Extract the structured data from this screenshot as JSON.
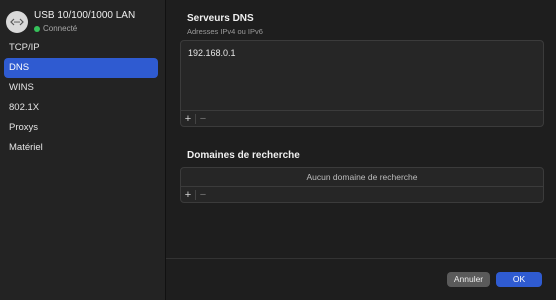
{
  "sidebar": {
    "interface": {
      "icon": "ethernet-icon",
      "title": "USB 10/100/1000 LAN",
      "status": "Connecté",
      "status_color": "#36c25b"
    },
    "items": [
      {
        "label": "TCP/IP"
      },
      {
        "label": "DNS",
        "selected": true
      },
      {
        "label": "WINS"
      },
      {
        "label": "802.1X"
      },
      {
        "label": "Proxys"
      },
      {
        "label": "Matériel"
      }
    ]
  },
  "dns_servers": {
    "title": "Serveurs DNS",
    "subtitle": "Adresses IPv4 ou IPv6",
    "entries": [
      "192.168.0.1"
    ],
    "add_label": "+",
    "remove_label": "−"
  },
  "search_domains": {
    "title": "Domaines de recherche",
    "empty_text": "Aucun domaine de recherche",
    "add_label": "+",
    "remove_label": "−"
  },
  "footer": {
    "cancel_label": "Annuler",
    "ok_label": "OK"
  },
  "colors": {
    "accent": "#2f5bd1",
    "background": "#1e1e1e",
    "sidebar": "#232323"
  }
}
